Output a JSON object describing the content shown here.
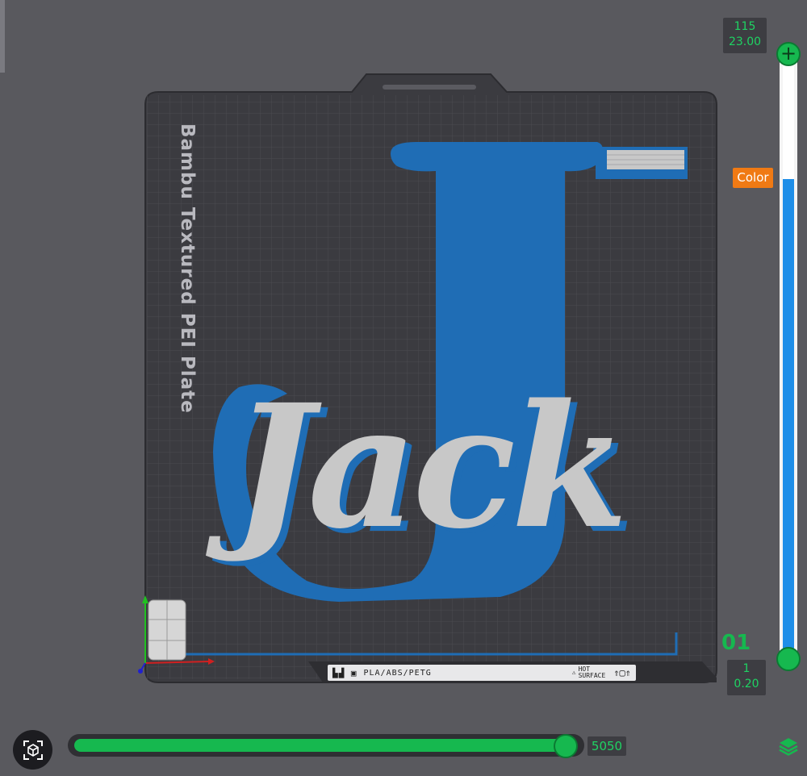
{
  "plate": {
    "label": "Bambu Textured PEI Plate",
    "info_logo": "▙▟ ▣",
    "material": "PLA/ABS/PETG",
    "hot_line1": "HOT",
    "hot_line2": "SURFACE",
    "arrows": "⇑▢⇑"
  },
  "model": {
    "text": "Jack",
    "colors": {
      "primary": "#1f6db5",
      "secondary": "#c8c8c8"
    }
  },
  "layer_slider": {
    "top_layer": "115",
    "top_height": "23.00",
    "bottom_layer": "1",
    "bottom_height": "0.20",
    "color_tag": "Color",
    "current_layer_badge": "01",
    "handle_top_icon": "+",
    "colors": {
      "track": "#f4f4f4",
      "fill": "#1e8ee8",
      "handle": "#16b84f",
      "tag": "#f07a14"
    }
  },
  "move_slider": {
    "value": "5050",
    "progress": 1.0
  },
  "icons": {
    "camera": "cube-focus-icon",
    "layers": "layers-icon"
  }
}
